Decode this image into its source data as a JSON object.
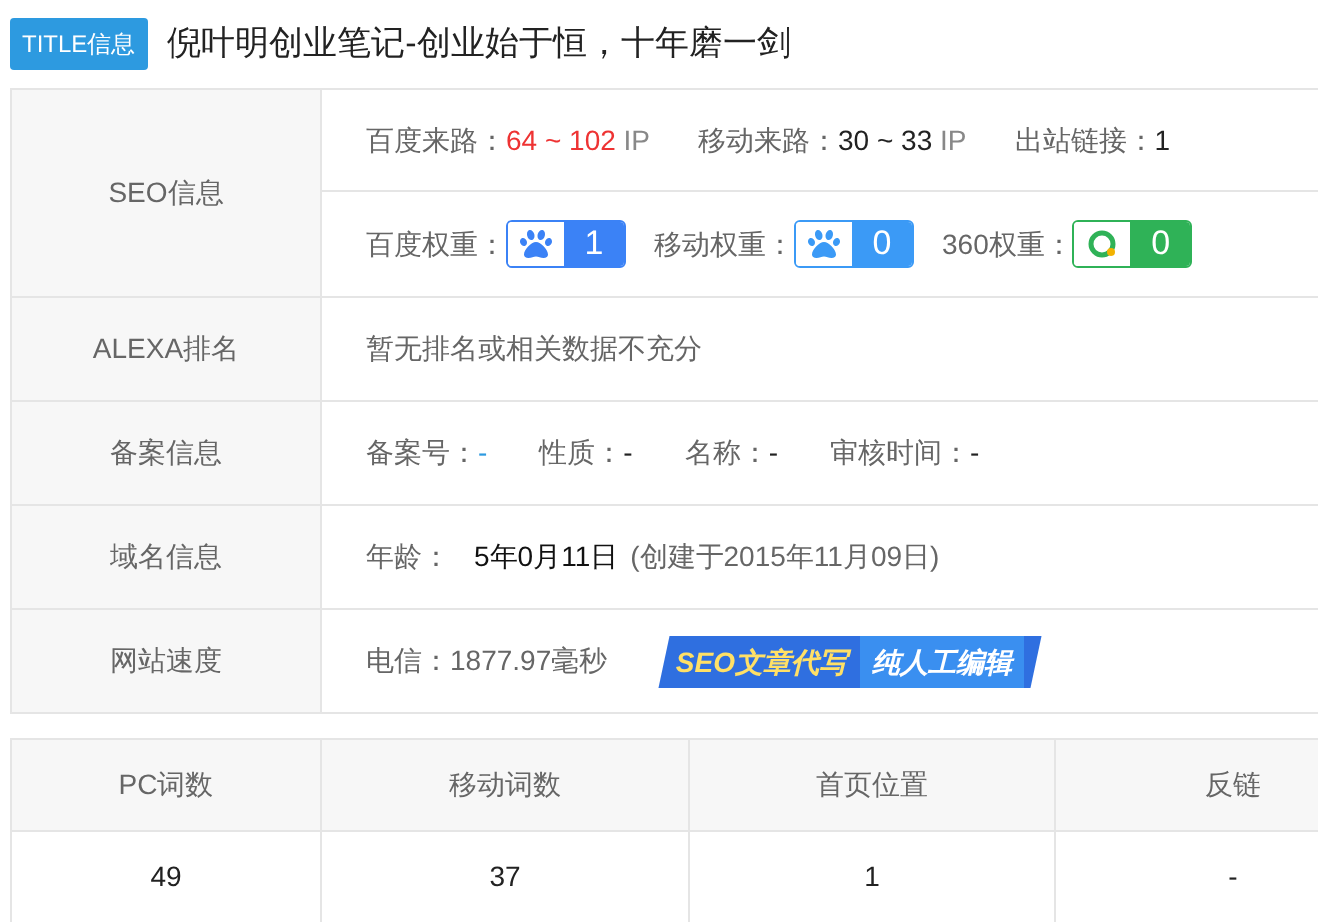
{
  "title": {
    "badge": "TITLE信息",
    "text": "倪叶明创业笔记-创业始于恒，十年磨一剑"
  },
  "info": {
    "seo": {
      "label": "SEO信息",
      "traffic": [
        {
          "label": "百度来路：",
          "value": "64 ~ 102",
          "unit": "IP",
          "highlight": true
        },
        {
          "label": "移动来路：",
          "value": "30 ~ 33",
          "unit": "IP",
          "highlight": false
        },
        {
          "label": "出站链接：",
          "value": "1",
          "highlight": false
        }
      ],
      "weights": [
        {
          "label": "百度权重：",
          "value": "1",
          "kind": "paw",
          "color": "#3b82f6"
        },
        {
          "label": "移动权重：",
          "value": "0",
          "kind": "paw",
          "color": "#3b9af6"
        },
        {
          "label": "360权重：",
          "value": "0",
          "kind": "ring",
          "color": "#2fb257"
        }
      ]
    },
    "alexa": {
      "label": "ALEXA排名",
      "text": "暂无排名或相关数据不充分"
    },
    "icp": {
      "label": "备案信息",
      "fields": [
        {
          "label": "备案号：",
          "value": "-",
          "link": true
        },
        {
          "label": "性质：",
          "value": "-",
          "link": false
        },
        {
          "label": "名称：",
          "value": "-",
          "link": false
        },
        {
          "label": "审核时间：",
          "value": "-",
          "link": false
        }
      ]
    },
    "domain": {
      "label": "域名信息",
      "age_label": "年龄：",
      "age": "5年0月11日",
      "created": "(创建于2015年11月09日)"
    },
    "speed": {
      "label": "网站速度",
      "text": "电信：1877.97毫秒",
      "banner": [
        "SEO文章代写",
        "纯人工编辑"
      ]
    }
  },
  "words": {
    "columns": [
      "PC词数",
      "移动词数",
      "首页位置",
      "反链"
    ],
    "values": [
      "49",
      "37",
      "1",
      "-"
    ]
  }
}
